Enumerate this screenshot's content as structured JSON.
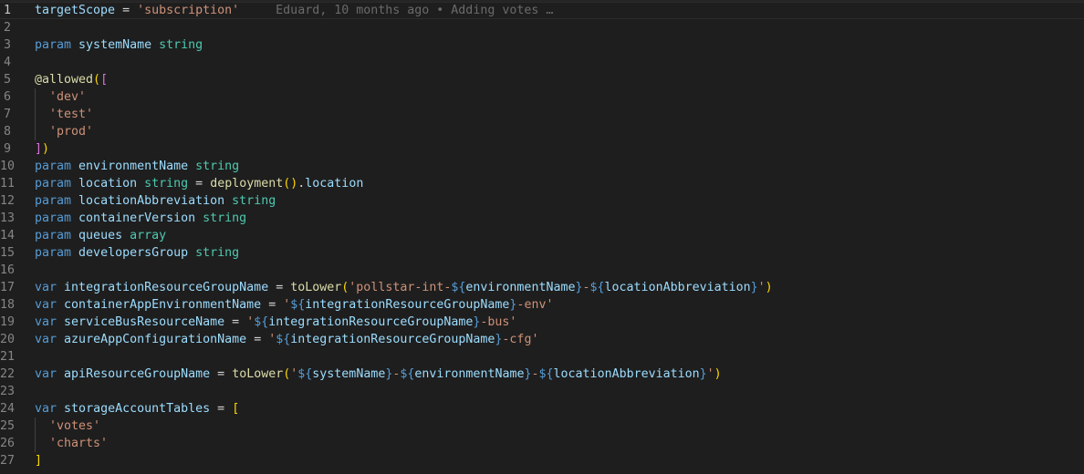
{
  "editor": {
    "active_line": 1,
    "blame": "Eduard, 10 months ago • Adding votes …",
    "lines": [
      {
        "n": "1",
        "tokens": [
          [
            "id",
            "targetScope"
          ],
          [
            "op",
            " = "
          ],
          [
            "str",
            "'subscription'"
          ]
        ]
      },
      {
        "n": "2",
        "tokens": []
      },
      {
        "n": "3",
        "tokens": [
          [
            "kw",
            "param"
          ],
          [
            "op",
            " "
          ],
          [
            "id",
            "systemName"
          ],
          [
            "op",
            " "
          ],
          [
            "ty",
            "string"
          ]
        ]
      },
      {
        "n": "4",
        "tokens": []
      },
      {
        "n": "5",
        "tokens": [
          [
            "dec",
            "@allowed"
          ],
          [
            "b1",
            "("
          ],
          [
            "b2",
            "["
          ]
        ]
      },
      {
        "n": "6",
        "tokens": [
          [
            "op",
            "  "
          ],
          [
            "str",
            "'dev'"
          ]
        ]
      },
      {
        "n": "7",
        "tokens": [
          [
            "op",
            "  "
          ],
          [
            "str",
            "'test'"
          ]
        ]
      },
      {
        "n": "8",
        "tokens": [
          [
            "op",
            "  "
          ],
          [
            "str",
            "'prod'"
          ]
        ]
      },
      {
        "n": "9",
        "tokens": [
          [
            "b2",
            "]"
          ],
          [
            "b1",
            ")"
          ]
        ]
      },
      {
        "n": "10",
        "tokens": [
          [
            "kw",
            "param"
          ],
          [
            "op",
            " "
          ],
          [
            "id",
            "environmentName"
          ],
          [
            "op",
            " "
          ],
          [
            "ty",
            "string"
          ]
        ]
      },
      {
        "n": "11",
        "tokens": [
          [
            "kw",
            "param"
          ],
          [
            "op",
            " "
          ],
          [
            "id",
            "location"
          ],
          [
            "op",
            " "
          ],
          [
            "ty",
            "string"
          ],
          [
            "op",
            " = "
          ],
          [
            "fn",
            "deployment"
          ],
          [
            "b1",
            "()"
          ],
          [
            "op",
            "."
          ],
          [
            "id",
            "location"
          ]
        ]
      },
      {
        "n": "12",
        "tokens": [
          [
            "kw",
            "param"
          ],
          [
            "op",
            " "
          ],
          [
            "id",
            "locationAbbreviation"
          ],
          [
            "op",
            " "
          ],
          [
            "ty",
            "string"
          ]
        ]
      },
      {
        "n": "13",
        "tokens": [
          [
            "kw",
            "param"
          ],
          [
            "op",
            " "
          ],
          [
            "id",
            "containerVersion"
          ],
          [
            "op",
            " "
          ],
          [
            "ty",
            "string"
          ]
        ]
      },
      {
        "n": "14",
        "tokens": [
          [
            "kw",
            "param"
          ],
          [
            "op",
            " "
          ],
          [
            "id",
            "queues"
          ],
          [
            "op",
            " "
          ],
          [
            "ty",
            "array"
          ]
        ]
      },
      {
        "n": "15",
        "tokens": [
          [
            "kw",
            "param"
          ],
          [
            "op",
            " "
          ],
          [
            "id",
            "developersGroup"
          ],
          [
            "op",
            " "
          ],
          [
            "ty",
            "string"
          ]
        ]
      },
      {
        "n": "16",
        "tokens": []
      },
      {
        "n": "17",
        "tokens": [
          [
            "kw",
            "var"
          ],
          [
            "op",
            " "
          ],
          [
            "id",
            "integrationResourceGroupName"
          ],
          [
            "op",
            " = "
          ],
          [
            "fn",
            "toLower"
          ],
          [
            "b1",
            "("
          ],
          [
            "str",
            "'pollstar-int-"
          ],
          [
            "interp",
            "${"
          ],
          [
            "id",
            "environmentName"
          ],
          [
            "interp",
            "}"
          ],
          [
            "str",
            "-"
          ],
          [
            "interp",
            "${"
          ],
          [
            "id",
            "locationAbbreviation"
          ],
          [
            "interp",
            "}"
          ],
          [
            "str",
            "'"
          ],
          [
            "b1",
            ")"
          ]
        ]
      },
      {
        "n": "18",
        "tokens": [
          [
            "kw",
            "var"
          ],
          [
            "op",
            " "
          ],
          [
            "id",
            "containerAppEnvironmentName"
          ],
          [
            "op",
            " = "
          ],
          [
            "str",
            "'"
          ],
          [
            "interp",
            "${"
          ],
          [
            "id",
            "integrationResourceGroupName"
          ],
          [
            "interp",
            "}"
          ],
          [
            "str",
            "-env'"
          ]
        ]
      },
      {
        "n": "19",
        "tokens": [
          [
            "kw",
            "var"
          ],
          [
            "op",
            " "
          ],
          [
            "id",
            "serviceBusResourceName"
          ],
          [
            "op",
            " = "
          ],
          [
            "str",
            "'"
          ],
          [
            "interp",
            "${"
          ],
          [
            "id",
            "integrationResourceGroupName"
          ],
          [
            "interp",
            "}"
          ],
          [
            "str",
            "-bus'"
          ]
        ]
      },
      {
        "n": "20",
        "tokens": [
          [
            "kw",
            "var"
          ],
          [
            "op",
            " "
          ],
          [
            "id",
            "azureAppConfigurationName"
          ],
          [
            "op",
            " = "
          ],
          [
            "str",
            "'"
          ],
          [
            "interp",
            "${"
          ],
          [
            "id",
            "integrationResourceGroupName"
          ],
          [
            "interp",
            "}"
          ],
          [
            "str",
            "-cfg'"
          ]
        ]
      },
      {
        "n": "21",
        "tokens": []
      },
      {
        "n": "22",
        "tokens": [
          [
            "kw",
            "var"
          ],
          [
            "op",
            " "
          ],
          [
            "id",
            "apiResourceGroupName"
          ],
          [
            "op",
            " = "
          ],
          [
            "fn",
            "toLower"
          ],
          [
            "b1",
            "("
          ],
          [
            "str",
            "'"
          ],
          [
            "interp",
            "${"
          ],
          [
            "id",
            "systemName"
          ],
          [
            "interp",
            "}"
          ],
          [
            "str",
            "-"
          ],
          [
            "interp",
            "${"
          ],
          [
            "id",
            "environmentName"
          ],
          [
            "interp",
            "}"
          ],
          [
            "str",
            "-"
          ],
          [
            "interp",
            "${"
          ],
          [
            "id",
            "locationAbbreviation"
          ],
          [
            "interp",
            "}"
          ],
          [
            "str",
            "'"
          ],
          [
            "b1",
            ")"
          ]
        ]
      },
      {
        "n": "23",
        "tokens": []
      },
      {
        "n": "24",
        "tokens": [
          [
            "kw",
            "var"
          ],
          [
            "op",
            " "
          ],
          [
            "id",
            "storageAccountTables"
          ],
          [
            "op",
            " = "
          ],
          [
            "b1",
            "["
          ]
        ]
      },
      {
        "n": "25",
        "tokens": [
          [
            "op",
            "  "
          ],
          [
            "str",
            "'votes'"
          ]
        ]
      },
      {
        "n": "26",
        "tokens": [
          [
            "op",
            "  "
          ],
          [
            "str",
            "'charts'"
          ]
        ]
      },
      {
        "n": "27",
        "tokens": [
          [
            "b1",
            "]"
          ]
        ]
      }
    ]
  }
}
